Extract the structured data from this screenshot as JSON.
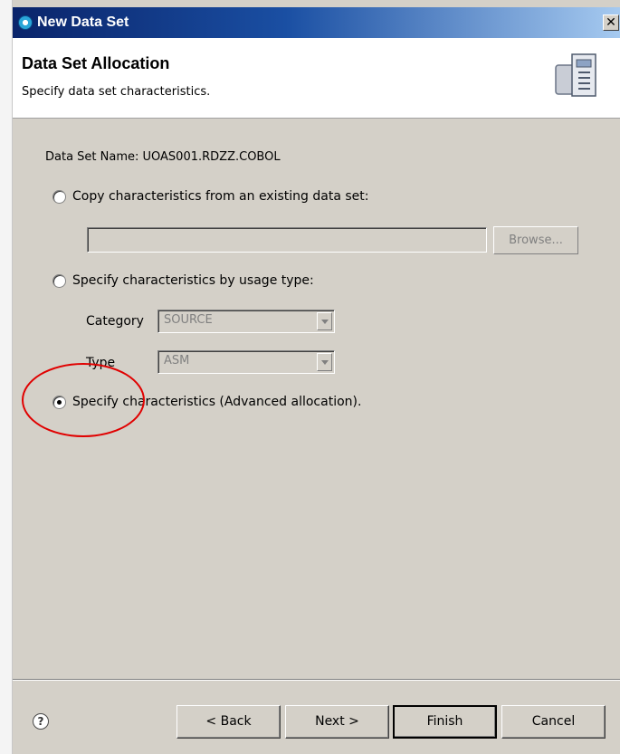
{
  "window": {
    "title": "New Data Set",
    "close_glyph": "✕"
  },
  "header": {
    "title": "Data Set Allocation",
    "description": "Specify data set characteristics.",
    "icon": "dataset-server-icon"
  },
  "form": {
    "dataset_name": "Data Set Name:  UOAS001.RDZZ.COBOL",
    "options": [
      {
        "label": "Copy characteristics from an existing data set:",
        "checked": false
      },
      {
        "label": "Specify characteristics by usage type:",
        "checked": false
      },
      {
        "label": "Specify characteristics  (Advanced allocation).",
        "checked": true
      }
    ],
    "existing_dataset_value": "",
    "browse_label": "Browse...",
    "category_label": "Category",
    "category_value": "SOURCE",
    "type_label": "Type",
    "type_value": "ASM"
  },
  "annotation": {
    "color": "#e00000"
  },
  "footer": {
    "help_glyph": "?",
    "back_label": "< Back",
    "next_label": "Next >",
    "finish_label": "Finish",
    "cancel_label": "Cancel"
  },
  "colors": {
    "titlebar_start": "#0a246a",
    "titlebar_end": "#a6caf0",
    "dialog_bg": "#d4d0c8"
  }
}
